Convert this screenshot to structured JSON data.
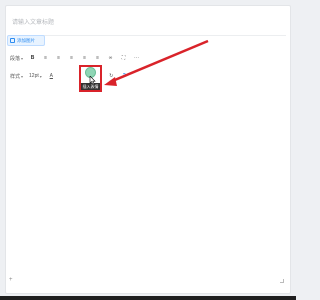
{
  "editor": {
    "title_placeholder": "请输入文章标题",
    "insert_button_label": "添加图片"
  },
  "toolbar_row1": {
    "paragraph_label": "段落",
    "bold": "B",
    "list_ordered": "≡",
    "list_bullet": "≡",
    "align_left": "≡",
    "align_center": "≡",
    "align_right": "≡",
    "link": "∞",
    "fullscreen": "⛶",
    "more": "···"
  },
  "toolbar_row2": {
    "style_label": "样式",
    "size_label": "12pt",
    "font_color": "A",
    "redo": "↻",
    "help": "?"
  },
  "tooltip": {
    "label": "插入表情"
  },
  "footer": {
    "plus": "+"
  },
  "colors": {
    "accent": "#2d8cf0",
    "highlight": "#d9232a"
  }
}
